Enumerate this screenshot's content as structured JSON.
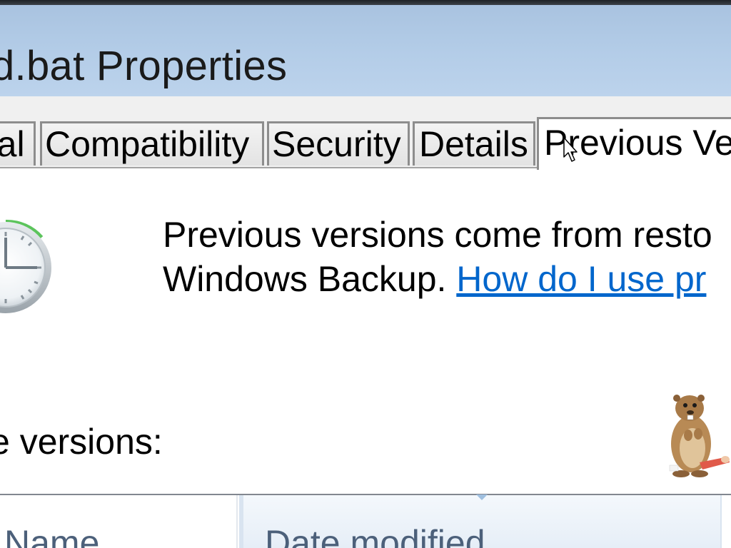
{
  "window": {
    "title": "d.bat Properties"
  },
  "tabs": [
    {
      "label": "ral",
      "selected": false
    },
    {
      "label": "Compatibility",
      "selected": false
    },
    {
      "label": "Security",
      "selected": false
    },
    {
      "label": "Details",
      "selected": false
    },
    {
      "label": "Previous Ve",
      "selected": true
    }
  ],
  "panel": {
    "icon": "clock-icon",
    "info_line1": "Previous versions come from resto",
    "info_line2_prefix": "Windows Backup. ",
    "info_link": "How do I use pr",
    "versions_label": "e versions:",
    "mascot_icon": "beaver-mascot-icon"
  },
  "list": {
    "columns": [
      "Name",
      "Date modified"
    ]
  },
  "colors": {
    "title_bar": "#b4cde8",
    "link": "#0066cc",
    "column_header_text": "#4c607a"
  }
}
